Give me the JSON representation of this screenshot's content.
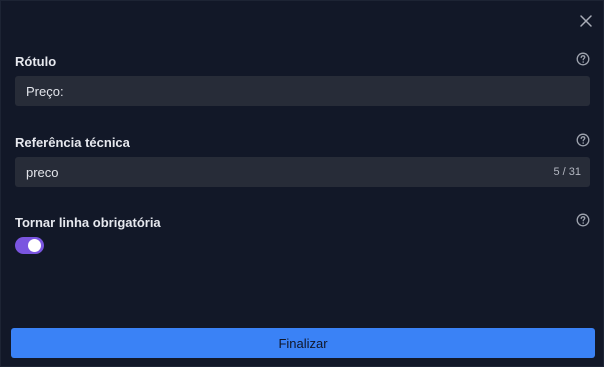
{
  "form": {
    "close_icon": "close-icon",
    "fields": {
      "label": {
        "title": "Rótulo",
        "value": "Preço:",
        "help_icon": "help-circle-icon"
      },
      "tech_ref": {
        "title": "Referência técnica",
        "value": "preco",
        "counter": "5 / 31",
        "help_icon": "help-circle-icon"
      },
      "required": {
        "title": "Tornar linha obrigatória",
        "checked": true,
        "help_icon": "help-circle-icon"
      }
    },
    "submit_label": "Finalizar"
  },
  "colors": {
    "background": "#121828",
    "input_background": "#272c38",
    "toggle_on": "#7a55e0",
    "primary_button": "#3a82f6"
  }
}
